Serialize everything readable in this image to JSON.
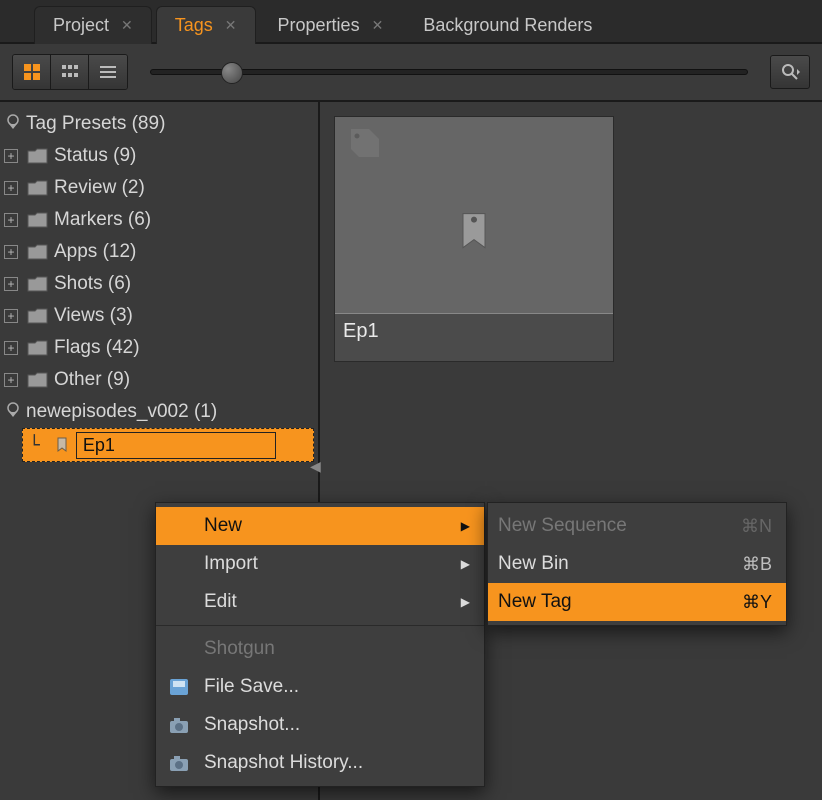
{
  "tabs": {
    "project": "Project",
    "tags": "Tags",
    "properties": "Properties",
    "renders": "Background Renders"
  },
  "tree": {
    "root": "Tag Presets (89)",
    "items": [
      "Status (9)",
      "Review (2)",
      "Markers (6)",
      "Apps (12)",
      "Shots (6)",
      "Views (3)",
      "Flags (42)",
      "Other (9)"
    ],
    "user_root": "newepisodes_v002 (1)",
    "editing": "Ep1"
  },
  "thumb": {
    "label": "Ep1"
  },
  "menu": {
    "new": "New",
    "import": "Import",
    "edit": "Edit",
    "shotgun": "Shotgun",
    "file_save": "File Save...",
    "snapshot": "Snapshot...",
    "snapshot_history": "Snapshot History..."
  },
  "submenu": {
    "new_sequence": {
      "label": "New Sequence",
      "sc": "⌘N"
    },
    "new_bin": {
      "label": "New Bin",
      "sc": "⌘B"
    },
    "new_tag": {
      "label": "New Tag",
      "sc": "⌘Y"
    }
  }
}
